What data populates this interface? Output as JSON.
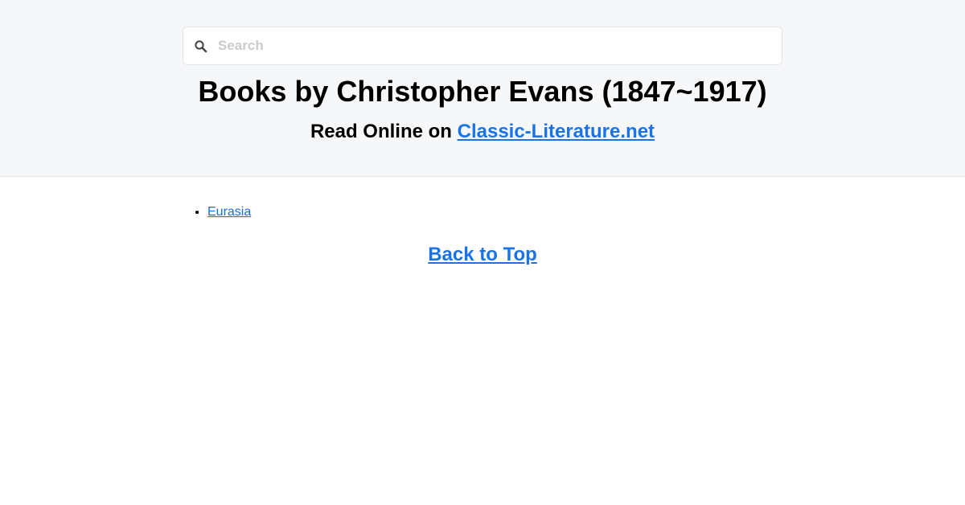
{
  "search": {
    "placeholder": "Search",
    "icon": "search-icon"
  },
  "header": {
    "title": "Books by Christopher Evans (1847~1917)",
    "subtitle_prefix": "Read Online on",
    "site_link": "Classic-Literature.net"
  },
  "books": [
    {
      "title": "Eurasia"
    }
  ],
  "footer": {
    "back_to_top": "Back to Top"
  },
  "colors": {
    "link": "#1a73e8",
    "header_bg": "#f6f7f9",
    "placeholder": "#c9cbce"
  }
}
